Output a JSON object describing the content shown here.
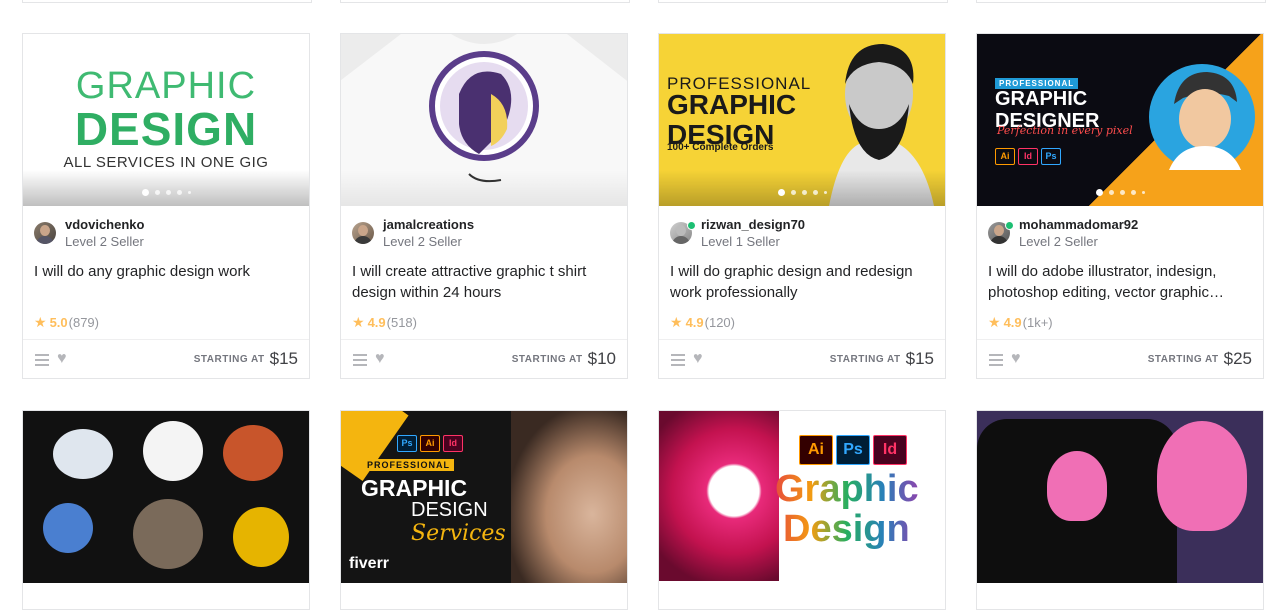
{
  "cards": [
    {
      "seller": "vdovichenko",
      "level": "Level 2 Seller",
      "title": "I will do any graphic design work",
      "rating": "5.0",
      "reviews": "(879)",
      "starting_label": "STARTING AT",
      "price": "$15",
      "thumb_text": {
        "line1": "GRAPHIC",
        "line2": "DESIGN",
        "line3": "ALL SERVICES IN ONE GIG"
      }
    },
    {
      "seller": "jamalcreations",
      "level": "Level 2 Seller",
      "title": "I will create attractive graphic t shirt design within 24 hours",
      "rating": "4.9",
      "reviews": "(518)",
      "starting_label": "STARTING AT",
      "price": "$10"
    },
    {
      "seller": "rizwan_design70",
      "level": "Level 1 Seller",
      "title": "I will do graphic design and redesign work professionally",
      "rating": "4.9",
      "reviews": "(120)",
      "starting_label": "STARTING AT",
      "price": "$15",
      "thumb_text": {
        "line1": "PROFESSIONAL",
        "line2": "GRAPHIC DESIGN",
        "line3": "100+ Complete Orders"
      }
    },
    {
      "seller": "mohammadomar92",
      "level": "Level 2 Seller",
      "title": "I will do adobe illustrator, indesign, photoshop editing, vector graphic…",
      "rating": "4.9",
      "reviews": "(1k+)",
      "starting_label": "STARTING AT",
      "price": "$25",
      "thumb_text": {
        "tag": "PROFESSIONAL",
        "line1": "GRAPHIC",
        "line2": "DESIGNER",
        "line3": "Perfection in every pixel",
        "apps": [
          "Ai",
          "Id",
          "Ps"
        ]
      }
    }
  ],
  "row2_thumbs": [
    {},
    {
      "apps": [
        "Ps",
        "Ai",
        "Id"
      ],
      "tag": "PROFESSIONAL",
      "line1": "GRAPHIC",
      "line2": "DESIGN",
      "line3": "Services",
      "brand": "fiverr"
    },
    {
      "apps": [
        "Ai",
        "Ps",
        "Id"
      ],
      "line1": "Graphic",
      "line2": "Design"
    },
    {}
  ],
  "colors": {
    "star": "#ffbe5b",
    "online": "#1dbf73",
    "border": "#e4e5e7"
  },
  "icons": [
    "star-icon",
    "menu-icon",
    "heart-icon"
  ]
}
